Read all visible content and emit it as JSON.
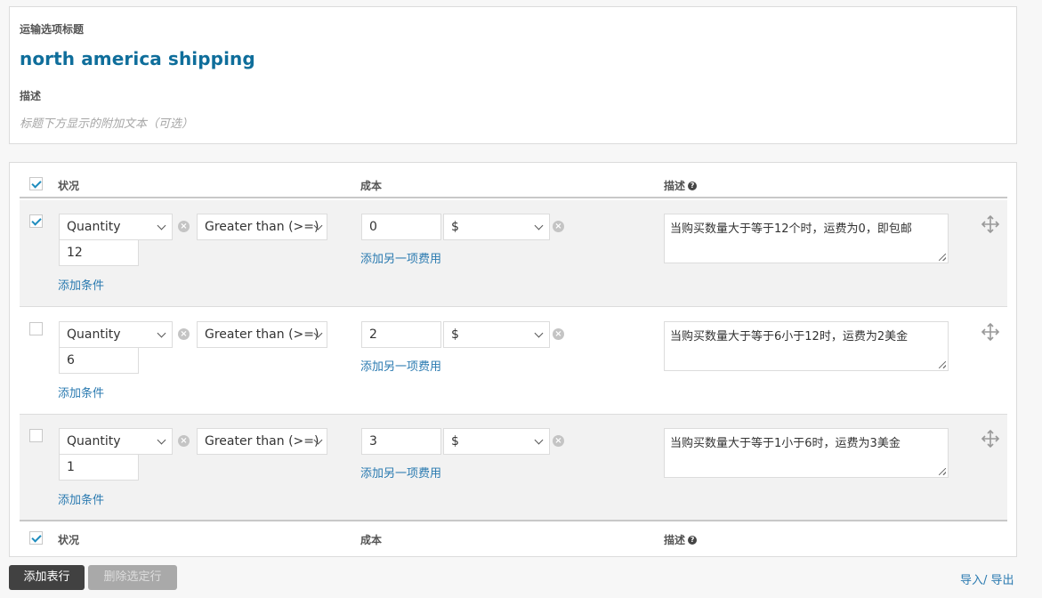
{
  "shipping_option": {
    "title_label": "运输选项标题",
    "title_value": "north america shipping",
    "description_label": "描述",
    "description_placeholder": "标题下方显示的附加文本（可选）"
  },
  "table": {
    "header": {
      "select_all_checked": true,
      "status": "状况",
      "cost": "成本",
      "description": "描述",
      "help_icon": "?"
    },
    "rows": [
      {
        "checked": true,
        "condition_type": "Quantity",
        "operator": "Greater than (>=)",
        "condition_value": "12",
        "add_condition": "添加条件",
        "cost_value": "0",
        "currency": "$",
        "add_cost": "添加另一项费用",
        "description": "当购买数量大于等于12个时，运费为0，即包邮"
      },
      {
        "checked": false,
        "condition_type": "Quantity",
        "operator": "Greater than (>=)",
        "condition_value": "6",
        "add_condition": "添加条件",
        "cost_value": "2",
        "currency": "$",
        "add_cost": "添加另一项费用",
        "description": "当购买数量大于等于6小于12时，运费为2美金"
      },
      {
        "checked": false,
        "condition_type": "Quantity",
        "operator": "Greater than (>=)",
        "condition_value": "1",
        "add_condition": "添加条件",
        "cost_value": "3",
        "currency": "$",
        "add_cost": "添加另一项费用",
        "description": "当购买数量大于等于1小于6时，运费为3美金"
      }
    ],
    "footer": {
      "select_all_checked": true,
      "status": "状况",
      "cost": "成本",
      "description": "描述",
      "help_icon": "?"
    }
  },
  "actions": {
    "add_row": "添加表行",
    "delete_selected": "删除选定行",
    "import_export": "导入/ 导出"
  },
  "icons": {
    "remove": "×",
    "move": "move-arrows-icon",
    "chevron": "chevron-down-icon"
  },
  "colors": {
    "title": "#0f6e9b",
    "link": "#2a7ab0",
    "checkbox_check": "#1e8cbe",
    "primary_button": "#414141",
    "disabled_button": "#a9a9a9"
  }
}
